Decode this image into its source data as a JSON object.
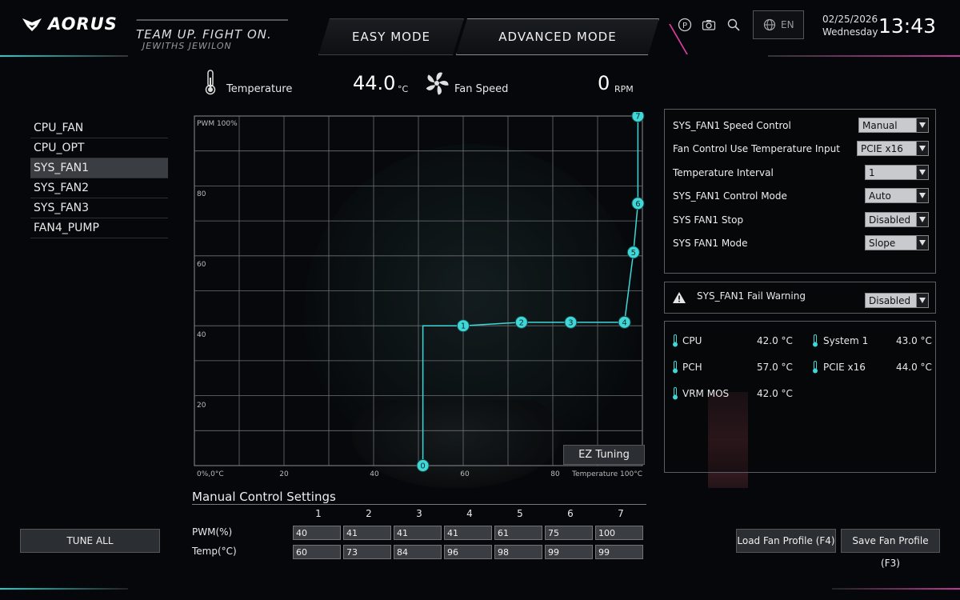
{
  "header": {
    "brand": "AORUS",
    "slogan_line1": "TEAM UP. FIGHT ON.",
    "slogan_line2": "JEWITHS JEWILON",
    "tabs": [
      {
        "label": "EASY MODE"
      },
      {
        "label": "ADVANCED MODE"
      }
    ],
    "language": "EN",
    "date": "02/25/2026",
    "weekday": "Wednesday",
    "time": "13:43",
    "icons": [
      "p-icon",
      "camera-icon",
      "search-icon",
      "globe-icon"
    ]
  },
  "readouts": {
    "temperature_label": "Temperature",
    "temperature_value": "44.0",
    "temperature_unit": "°C",
    "fan_label": "Fan Speed",
    "fan_value": "0",
    "fan_unit": "RPM"
  },
  "fans": [
    "CPU_FAN",
    "CPU_OPT",
    "SYS_FAN1",
    "SYS_FAN2",
    "SYS_FAN3",
    "FAN4_PUMP"
  ],
  "selected_fan_index": 2,
  "chart": {
    "y_top_label": "PWM 100%",
    "y_ticks": [
      "80",
      "60",
      "40",
      "20"
    ],
    "origin_label": "0%,0°C",
    "x_ticks": [
      "20",
      "40",
      "60",
      "80"
    ],
    "x_end_label": "Temperature 100°C",
    "ez_tuning": "EZ Tuning",
    "point_labels": [
      "0",
      "1",
      "2",
      "3",
      "4",
      "5",
      "6",
      "7"
    ]
  },
  "chart_data": {
    "type": "line",
    "xlabel": "Temperature",
    "ylabel": "PWM",
    "xlim": [
      0,
      100
    ],
    "ylim": [
      0,
      100
    ],
    "grid": true,
    "points": [
      {
        "label": "0",
        "x": 51,
        "y": 0
      },
      {
        "label": "1",
        "x": 60,
        "y": 40
      },
      {
        "label": "2",
        "x": 73,
        "y": 41
      },
      {
        "label": "3",
        "x": 84,
        "y": 41
      },
      {
        "label": "4",
        "x": 96,
        "y": 41
      },
      {
        "label": "5",
        "x": 98,
        "y": 61
      },
      {
        "label": "6",
        "x": 99,
        "y": 75
      },
      {
        "label": "7",
        "x": 99,
        "y": 100
      }
    ],
    "color": "#3fd7d7"
  },
  "settings": [
    {
      "label": "SYS_FAN1 Speed Control",
      "value": "Manual"
    },
    {
      "label": "Fan Control Use Temperature Input",
      "value": "PCIE x16"
    },
    {
      "label": "Temperature Interval",
      "value": "1"
    },
    {
      "label": "SYS_FAN1 Control Mode",
      "value": "Auto"
    },
    {
      "label": "SYS FAN1 Stop",
      "value": "Disabled"
    },
    {
      "label": "SYS FAN1 Mode",
      "value": "Slope"
    }
  ],
  "fail_warning": {
    "label": "SYS_FAN1 Fail Warning",
    "value": "Disabled"
  },
  "temps": [
    {
      "name": "CPU",
      "value": "42.0 °C"
    },
    {
      "name": "System 1",
      "value": "43.0 °C"
    },
    {
      "name": "PCH",
      "value": "57.0 °C"
    },
    {
      "name": "PCIE x16",
      "value": "44.0 °C"
    },
    {
      "name": "VRM MOS",
      "value": "42.0 °C"
    }
  ],
  "manual": {
    "title": "Manual Control Settings",
    "columns": [
      "1",
      "2",
      "3",
      "4",
      "5",
      "6",
      "7"
    ],
    "pwm_label": "PWM(%)",
    "temp_label": "Temp(°C)",
    "pwm": [
      "40",
      "41",
      "41",
      "41",
      "61",
      "75",
      "100"
    ],
    "temp": [
      "60",
      "73",
      "84",
      "96",
      "98",
      "99",
      "99"
    ]
  },
  "buttons": {
    "tune_all": "TUNE ALL",
    "load_profile": "Load Fan Profile (F4)",
    "save_profile": "Save Fan Profile (F3)"
  },
  "colors": {
    "accent_cyan": "#3fd7d7",
    "accent_pink": "#d43c9d"
  }
}
